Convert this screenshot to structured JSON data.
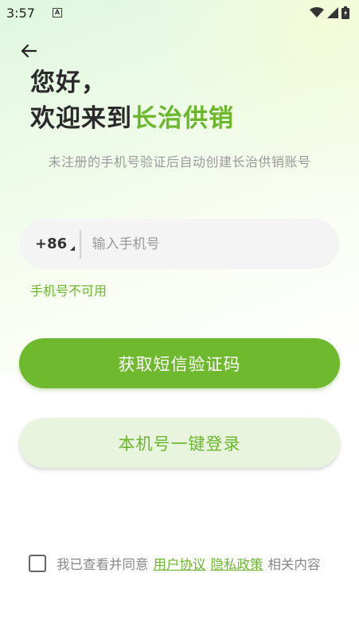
{
  "status_bar": {
    "time": "3:57",
    "app_icon_letter": "A"
  },
  "header": {
    "greeting": "您好，",
    "welcome_prefix": "欢迎来到",
    "brand_name": "长治供销"
  },
  "subtitle": "未注册的手机号验证后自动创建长治供销账号",
  "phone": {
    "country_code": "+86",
    "placeholder": "输入手机号",
    "value": ""
  },
  "error_message": "手机号不可用",
  "buttons": {
    "get_code": "获取短信验证码",
    "one_click_login": "本机号一键登录"
  },
  "agreement": {
    "prefix": "我已查看并同意",
    "user_agreement": "用户协议",
    "privacy_policy": "隐私政策",
    "suffix": "相关内容",
    "checked": false
  },
  "colors": {
    "brand_green": "#6ab72c",
    "button_green": "#6fb92f",
    "button_light": "#e9f4df"
  }
}
